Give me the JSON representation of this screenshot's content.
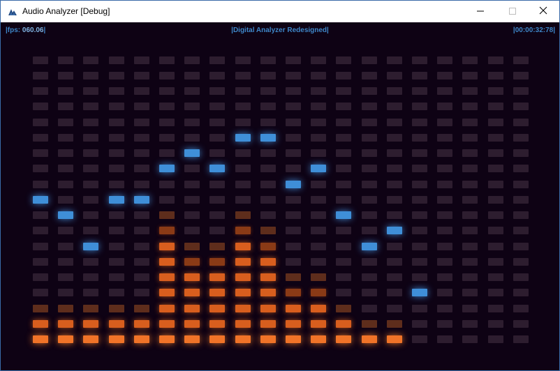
{
  "window": {
    "title": "Audio Analyzer [Debug]",
    "icon": "audio-analyzer-icon",
    "controls": [
      "minimize-icon",
      "maximize-icon",
      "close-icon"
    ]
  },
  "hud": {
    "fps_label": "|fps: ",
    "fps_value": "060.06",
    "fps_suffix": "|",
    "center_text": "|Digital Analyzer Redesigned|",
    "time_text": "|00:00:32:78|"
  },
  "colors": {
    "background": "#0e0214",
    "cell_off": "#2d1d2f",
    "bar_orange": "#f07328",
    "peak_blue": "#3f8fd8",
    "hud_text": "#3e86c8"
  },
  "analyzer": {
    "columns": 20,
    "rows": 19,
    "bar_levels": [
      2,
      2,
      2,
      2,
      2,
      8,
      6,
      6,
      8,
      7,
      4,
      4,
      2,
      1,
      1,
      0,
      0,
      0,
      0,
      0
    ],
    "peak_levels": [
      9,
      8,
      6,
      9,
      9,
      11,
      12,
      11,
      13,
      13,
      10,
      11,
      8,
      6,
      7,
      3,
      null,
      null,
      null,
      null
    ]
  }
}
